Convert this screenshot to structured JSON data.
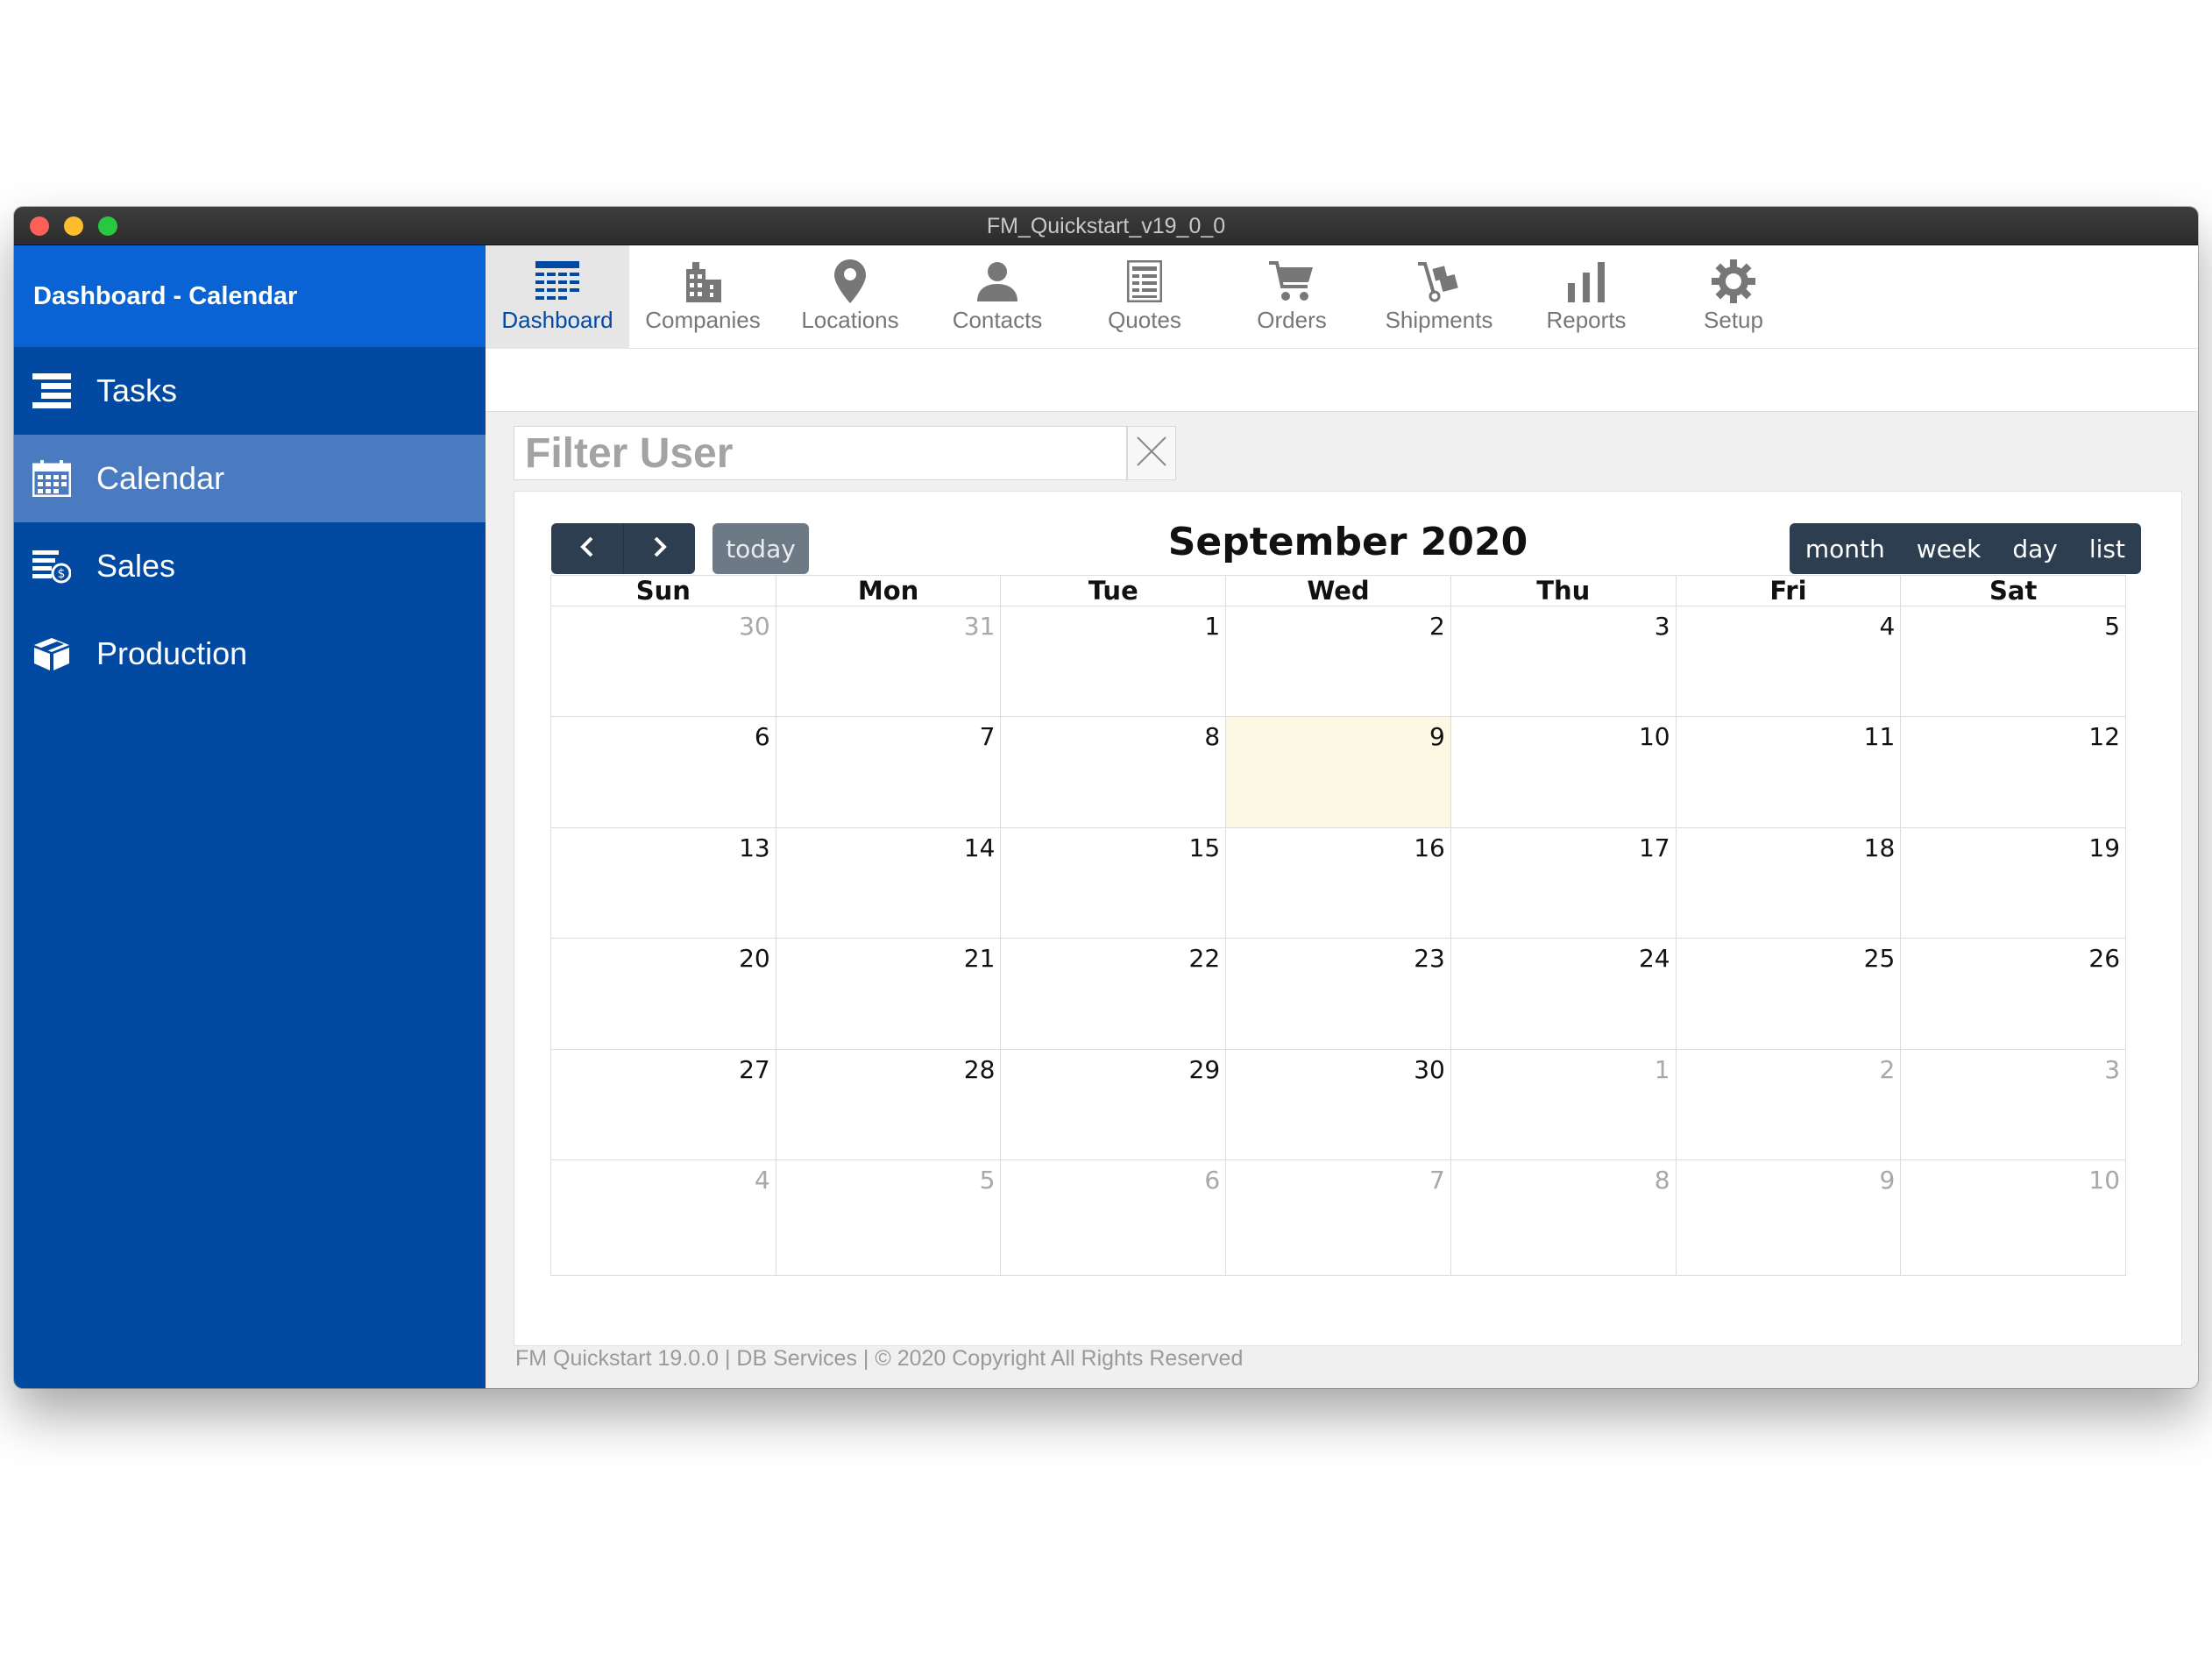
{
  "window": {
    "title": "FM_Quickstart_v19_0_0"
  },
  "sidebar": {
    "header": "Dashboard - Calendar",
    "items": [
      {
        "label": "Tasks",
        "icon": "list-icon"
      },
      {
        "label": "Calendar",
        "icon": "calendar-icon",
        "active": true
      },
      {
        "label": "Sales",
        "icon": "sales-icon"
      },
      {
        "label": "Production",
        "icon": "box-icon"
      }
    ]
  },
  "nav": {
    "items": [
      {
        "label": "Dashboard",
        "icon": "dashboard-icon",
        "active": true
      },
      {
        "label": "Companies",
        "icon": "building-icon"
      },
      {
        "label": "Locations",
        "icon": "map-pin-icon"
      },
      {
        "label": "Contacts",
        "icon": "person-icon"
      },
      {
        "label": "Quotes",
        "icon": "document-icon"
      },
      {
        "label": "Orders",
        "icon": "cart-icon"
      },
      {
        "label": "Shipments",
        "icon": "hand-truck-icon"
      },
      {
        "label": "Reports",
        "icon": "bar-chart-icon"
      },
      {
        "label": "Setup",
        "icon": "gear-icon"
      }
    ]
  },
  "filter": {
    "placeholder": "Filter User",
    "value": ""
  },
  "calendar": {
    "title": "September 2020",
    "today_label": "today",
    "views": [
      "month",
      "week",
      "day",
      "list"
    ],
    "weekdays": [
      "Sun",
      "Mon",
      "Tue",
      "Wed",
      "Thu",
      "Fri",
      "Sat"
    ],
    "weeks": [
      [
        "30",
        "31",
        "1",
        "2",
        "3",
        "4",
        "5"
      ],
      [
        "6",
        "7",
        "8",
        "9",
        "10",
        "11",
        "12"
      ],
      [
        "13",
        "14",
        "15",
        "16",
        "17",
        "18",
        "19"
      ],
      [
        "20",
        "21",
        "22",
        "23",
        "24",
        "25",
        "26"
      ],
      [
        "27",
        "28",
        "29",
        "30",
        "1",
        "2",
        "3"
      ],
      [
        "4",
        "5",
        "6",
        "7",
        "8",
        "9",
        "10"
      ]
    ],
    "today": "9",
    "colors": {
      "header_buttons": "#2c3e50",
      "today_button": "#6d7a86",
      "today_cell": "#fcf8e3"
    }
  },
  "footer": {
    "text": "FM Quickstart 19.0.0  | DB Services | © 2020 Copyright All Rights Reserved"
  },
  "colors": {
    "sidebar": "#0249a1",
    "sidebar_header": "#0a63d4",
    "sidebar_active": "#4a7ac0",
    "nav_active_text": "#0249a1"
  }
}
